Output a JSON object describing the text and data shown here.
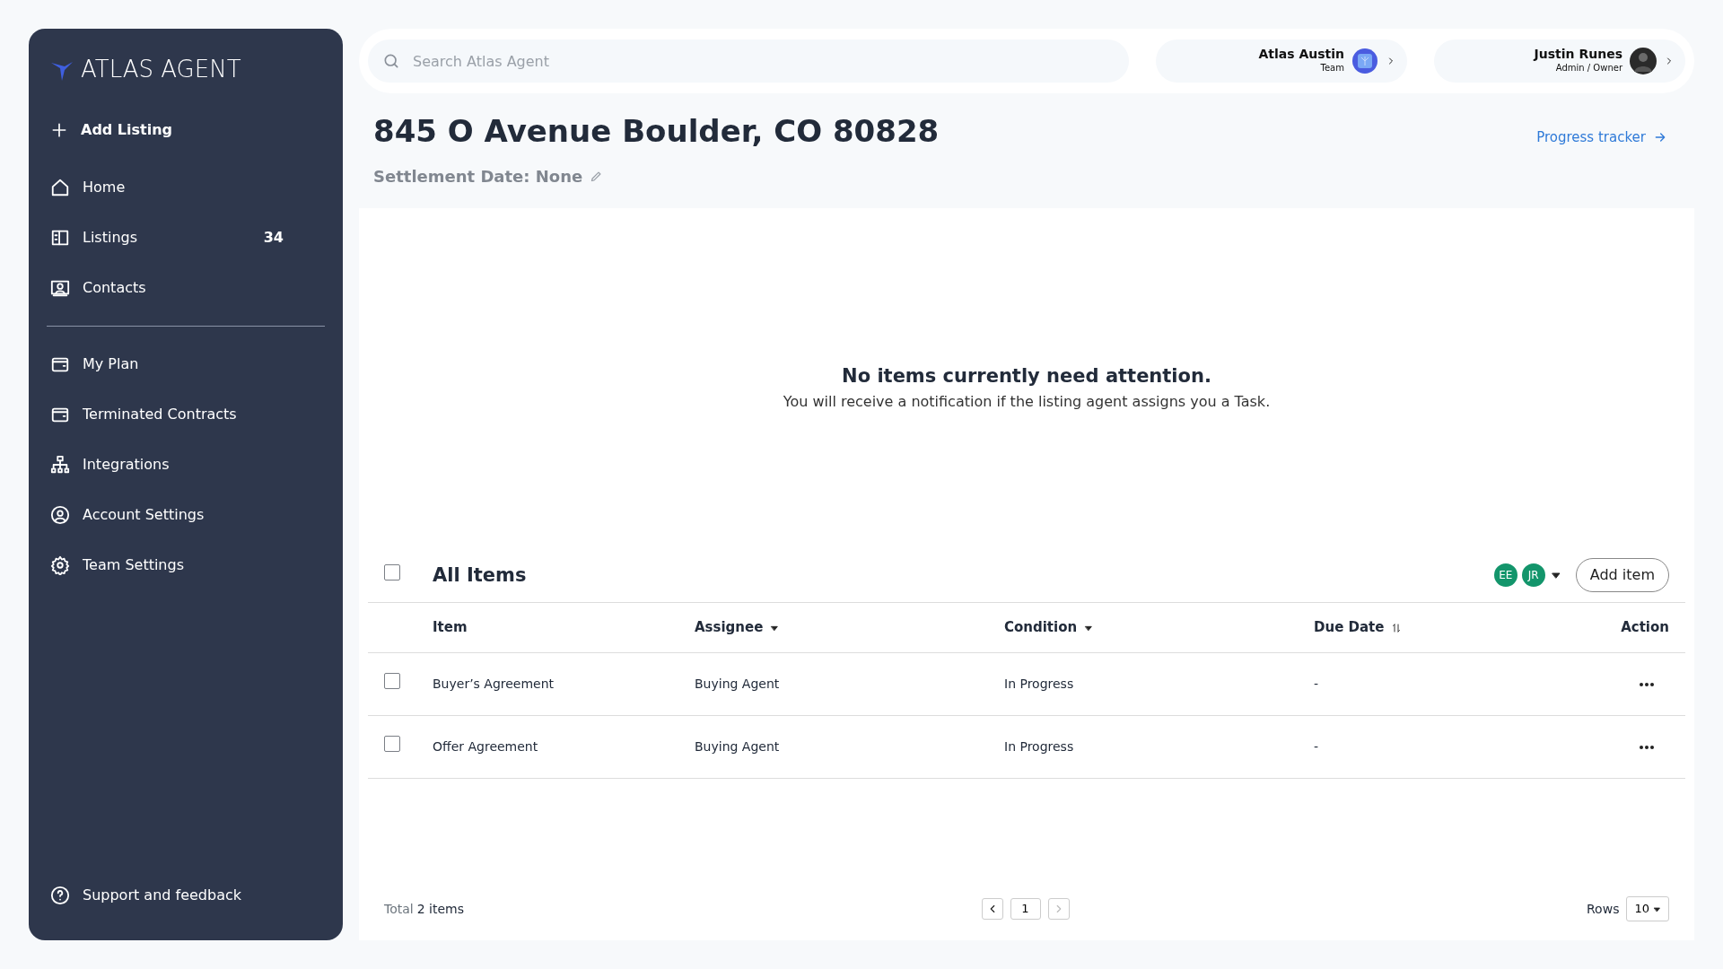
{
  "sidebar": {
    "logo": "ATLAS AGENT",
    "add_button": "Add Listing",
    "items": [
      {
        "label": "Home"
      },
      {
        "label": "Listings",
        "count": "34"
      },
      {
        "label": "Contacts"
      }
    ],
    "items_2": [
      {
        "label": "My Plan"
      },
      {
        "label": "Terminated Contracts"
      },
      {
        "label": "Integrations"
      },
      {
        "label": "Account Settings"
      },
      {
        "label": "Team Settings"
      }
    ],
    "footer_item": "Support and feedback"
  },
  "search": {
    "placeholder": "Search Atlas Agent"
  },
  "accounts": [
    {
      "name": "Atlas Austin",
      "role": "Team",
      "kind": "team"
    },
    {
      "name": "Justin Runes",
      "role": "Admin / Owner",
      "kind": "person"
    }
  ],
  "title": "845 O Avenue Boulder, CO 80828",
  "settlement": "Settlement Date: None",
  "progress_link": "Progress tracker",
  "empty": {
    "heading": "No items currently need attention.",
    "text": "You will receive a notification if the listing agent assigns you a Task."
  },
  "items_table": {
    "title": "All Items",
    "checked": false,
    "assignees": [
      "EE",
      "JR"
    ],
    "add_button": "Add item",
    "columns": [
      {
        "label": "Item",
        "kind": "plain"
      },
      {
        "label": "Assignee",
        "kind": "filter"
      },
      {
        "label": "Condition",
        "kind": "filter"
      },
      {
        "label": "Due Date",
        "kind": "sort"
      },
      {
        "label": "Action",
        "kind": "plain"
      }
    ],
    "rows": [
      {
        "checked": false,
        "cells": [
          "Buyer’s Agreement",
          "Buying Agent",
          "In Progress",
          "-"
        ]
      },
      {
        "checked": false,
        "cells": [
          "Offer Agreement",
          "Buying Agent",
          "In Progress",
          "-"
        ]
      }
    ]
  },
  "footer": {
    "total_label": "Total",
    "total_value": "2 items",
    "page": "1",
    "prev_disabled": false,
    "next_disabled": true,
    "rows_label": "Rows",
    "rows_value": "10"
  }
}
